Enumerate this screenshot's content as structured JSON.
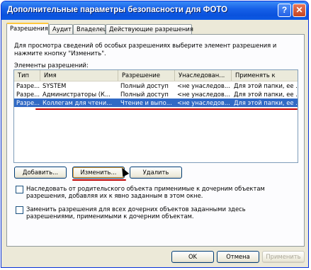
{
  "window": {
    "title": "Дополнительные параметры безопасности для ФОТО"
  },
  "tabs": [
    "Разрешения",
    "Аудит",
    "Владелец",
    "Действующие разрешения"
  ],
  "description": "Для просмотра сведений об особых разрешениях выберите элемент разрешения и нажмите кнопку \"Изменить\".",
  "list_label": "Элементы разрешений:",
  "columns": [
    "Тип",
    "Имя",
    "Разрешение",
    "Унаследован...",
    "Применять к"
  ],
  "rows": [
    [
      "Разре...",
      "SYSTEM",
      "Полный доступ",
      "<не унаследов...",
      "Для этой папки, ее ..."
    ],
    [
      "Разре...",
      "Администраторы (К...",
      "Полный доступ",
      "<не унаследов...",
      "Для этой папки, ее ..."
    ],
    [
      "Разре...",
      "Коллегам для чтени...",
      "Чтение и выпо...",
      "<не унаследов...",
      "Для этой папки, ее ..."
    ]
  ],
  "buttons": {
    "add": "Добавить...",
    "edit": "Изменить...",
    "delete": "Удалить"
  },
  "checkbox_inherit": "Наследовать от родительского объекта применимые к дочерним объектам разрешения, добавляя их к явно заданным в этом окне.",
  "checkbox_replace": "Заменить разрешения для всех дочерних объектов заданными здесь разрешениями, применимыми к дочерним объектам.",
  "dialog_buttons": {
    "ok": "OK",
    "cancel": "Отмена",
    "apply": "Применить"
  },
  "titlebar_buttons": {
    "help": "?",
    "close": "✕"
  },
  "colors": {
    "titlebar": "#0a52dd",
    "selection": "#316ac5",
    "underline": "#c00000"
  }
}
